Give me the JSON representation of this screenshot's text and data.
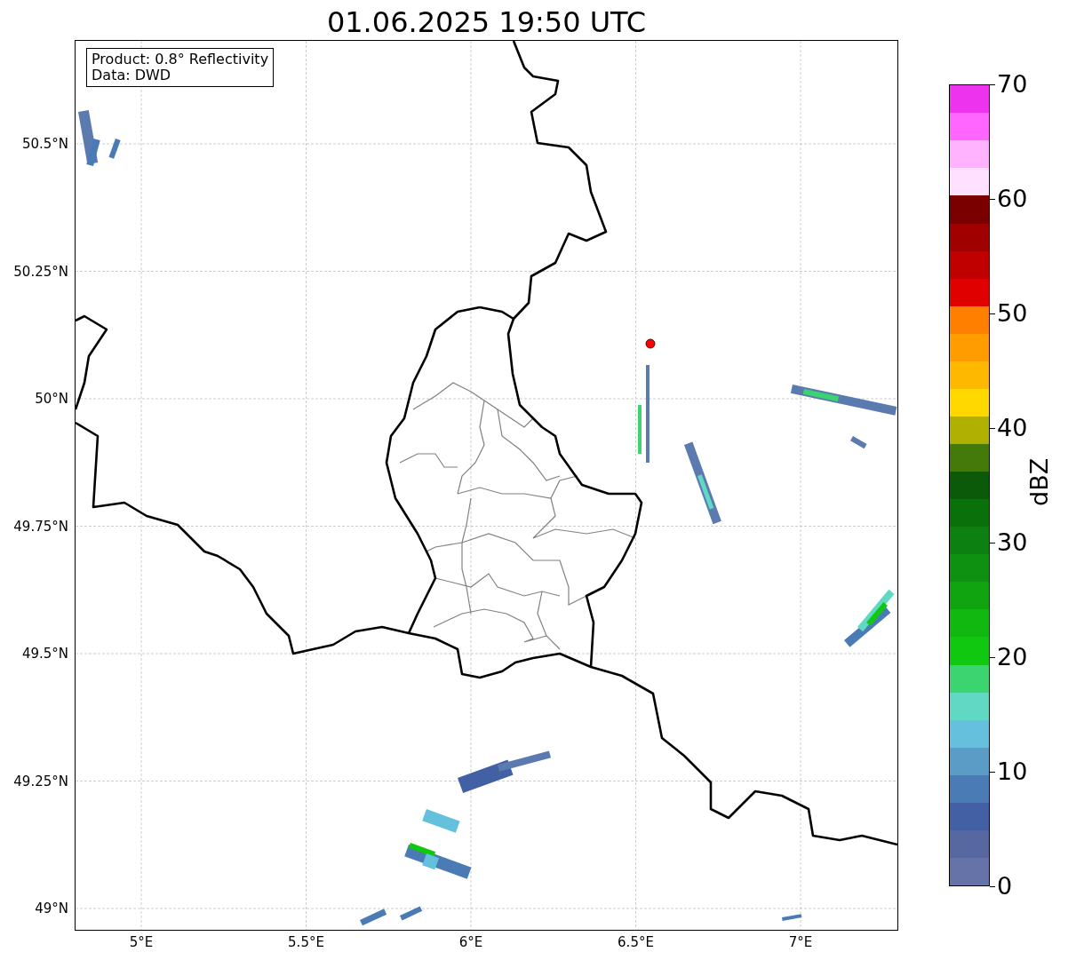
{
  "title": "01.06.2025 19:50 UTC",
  "map": {
    "info_box": [
      "Product: 0.8° Reflectivity",
      "Data: DWD"
    ],
    "lat_labels": [
      "50.5°N",
      "50.25°N",
      "50°N",
      "49.75°N",
      "49.5°N",
      "49.25°N",
      "49°N"
    ],
    "lon_labels": [
      "5°E",
      "5.5°E",
      "6°E",
      "6.5°E",
      "7°E"
    ]
  },
  "colorbar": {
    "label": "dBZ",
    "ticks": [
      "70",
      "60",
      "50",
      "40",
      "30",
      "20",
      "10",
      "0"
    ],
    "bins": [
      {
        "color": "#6573a8"
      },
      {
        "color": "#5768a0"
      },
      {
        "color": "#4460a4"
      },
      {
        "color": "#4a7bb4"
      },
      {
        "color": "#5a9cc6"
      },
      {
        "color": "#64c0dc"
      },
      {
        "color": "#60d8c4"
      },
      {
        "color": "#3cd470"
      },
      {
        "color": "#10c810"
      },
      {
        "color": "#10b810"
      },
      {
        "color": "#10a410"
      },
      {
        "color": "#0e9010"
      },
      {
        "color": "#0c8010"
      },
      {
        "color": "#0a700a"
      },
      {
        "color": "#0a5a0a"
      },
      {
        "color": "#447a0a"
      },
      {
        "color": "#b0b000"
      },
      {
        "color": "#ffd800"
      },
      {
        "color": "#ffb800"
      },
      {
        "color": "#ff9c00"
      },
      {
        "color": "#ff8000"
      },
      {
        "color": "#e00000"
      },
      {
        "color": "#c00000"
      },
      {
        "color": "#a00000"
      },
      {
        "color": "#7a0000"
      },
      {
        "color": "#ffe0ff"
      },
      {
        "color": "#ffb3ff"
      },
      {
        "color": "#ff66ff"
      },
      {
        "color": "#ee33ee"
      }
    ]
  }
}
